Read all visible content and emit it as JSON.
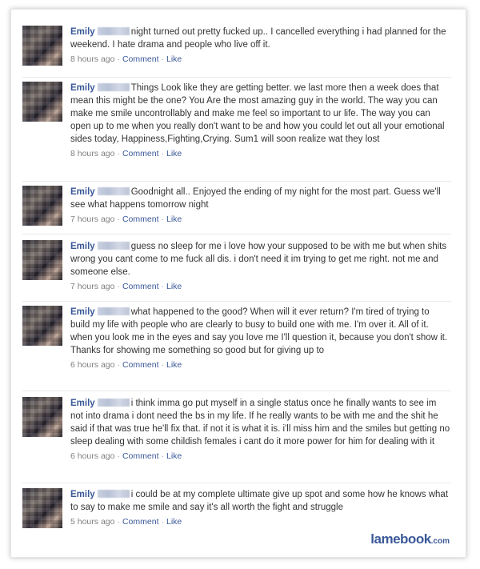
{
  "brand": {
    "main": "lamebook",
    "suffix": ".com"
  },
  "posts": [
    {
      "name": "Emily",
      "text": "night turned out pretty fucked up.. I cancelled everything i had planned for the weekend. I hate drama and people who live off it.",
      "time": "8 hours ago",
      "comment": "Comment",
      "like": "Like"
    },
    {
      "name": "Emily",
      "text": "Things Look like they are getting better. we last more then a week does that mean this might be the one? You Are the most amazing guy in the world. The way you can make me smile uncontrollably and make me feel so important to ur life. The way you can open up to me when you really don't want to be and how you could let out all your emotional sides today, Happiness,Fighting,Crying. Sum1 will soon realize wat they lost",
      "time": "8 hours ago",
      "comment": "Comment",
      "like": "Like"
    },
    {
      "name": "Emily",
      "text": "Goodnight all.. Enjoyed the ending of my night for the most part. Guess we'll see what happens tomorrow night",
      "time": "7 hours ago",
      "comment": "Comment",
      "like": "Like"
    },
    {
      "name": "Emily",
      "text": "guess no sleep for me i love how your supposed to be with me but when shits wrong you cant come to me fuck all dis. i don't need it im trying to get me right. not me and someone else.",
      "time": "7 hours ago",
      "comment": "Comment",
      "like": "Like"
    },
    {
      "name": "Emily",
      "text": "what happened to the good? When will it ever return? I'm tired of trying to build my life with people who are clearly to busy to build one with me. I'm over it. All of it. when you look me in the eyes and say you love me I'll question it, because you don't show it. Thanks for showing me something so good but for giving up to",
      "time": "6 hours ago",
      "comment": "Comment",
      "like": "Like"
    },
    {
      "name": "Emily",
      "text": "i think imma go put myself in a single status once he finally wants to see im not into drama i dont need the bs in my life. If he really wants to be with me and the shit he said if that was true he'll fix that. if not it is what it is. i'll miss him and the smiles but getting no sleep dealing with some childish females i cant do it more power for him for dealing with it",
      "time": "6 hours ago",
      "comment": "Comment",
      "like": "Like"
    },
    {
      "name": "Emily",
      "text": "i could be at my complete ultimate give up spot and some how he knows what to say to make me smile and say it's all worth the fight and struggle",
      "time": "5 hours ago",
      "comment": "Comment",
      "like": "Like"
    }
  ]
}
